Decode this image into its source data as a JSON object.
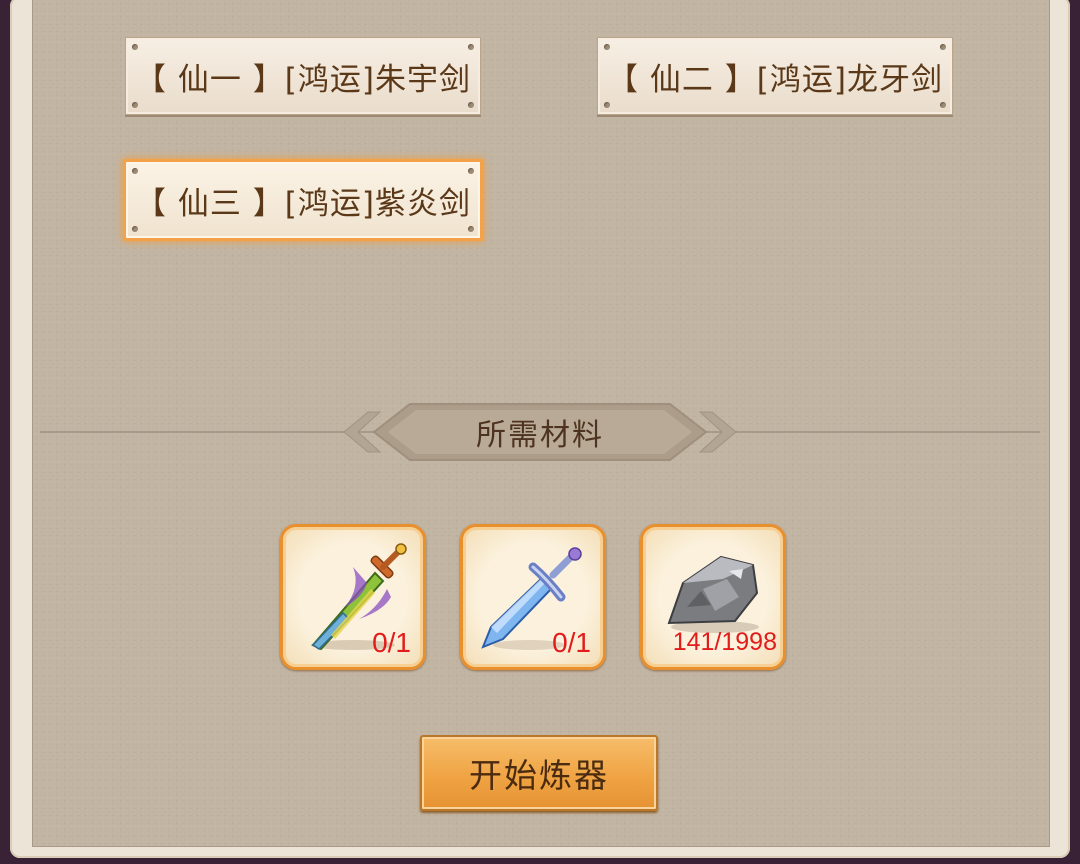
{
  "recipes": [
    {
      "label": "【 仙一 】[鸿运]朱宇剑",
      "selected": false
    },
    {
      "label": "【 仙二 】[鸿运]龙牙剑",
      "selected": false
    },
    {
      "label": "【 仙三 】[鸿运]紫炎剑",
      "selected": true
    }
  ],
  "materials_title": "所需材料",
  "materials": [
    {
      "icon": "green-purple-sword-icon",
      "count": "0/1"
    },
    {
      "icon": "blue-crystal-sword-icon",
      "count": "0/1"
    },
    {
      "icon": "grey-ore-stone-icon",
      "count": "141/1998"
    }
  ],
  "start_button": "开始炼器",
  "colors": {
    "count_red": "#e21b1b",
    "slot_border": "#e9902e",
    "selected_glow": "#f3a24a",
    "button_orange": "#f0a444",
    "text_brown": "#5a3818"
  }
}
